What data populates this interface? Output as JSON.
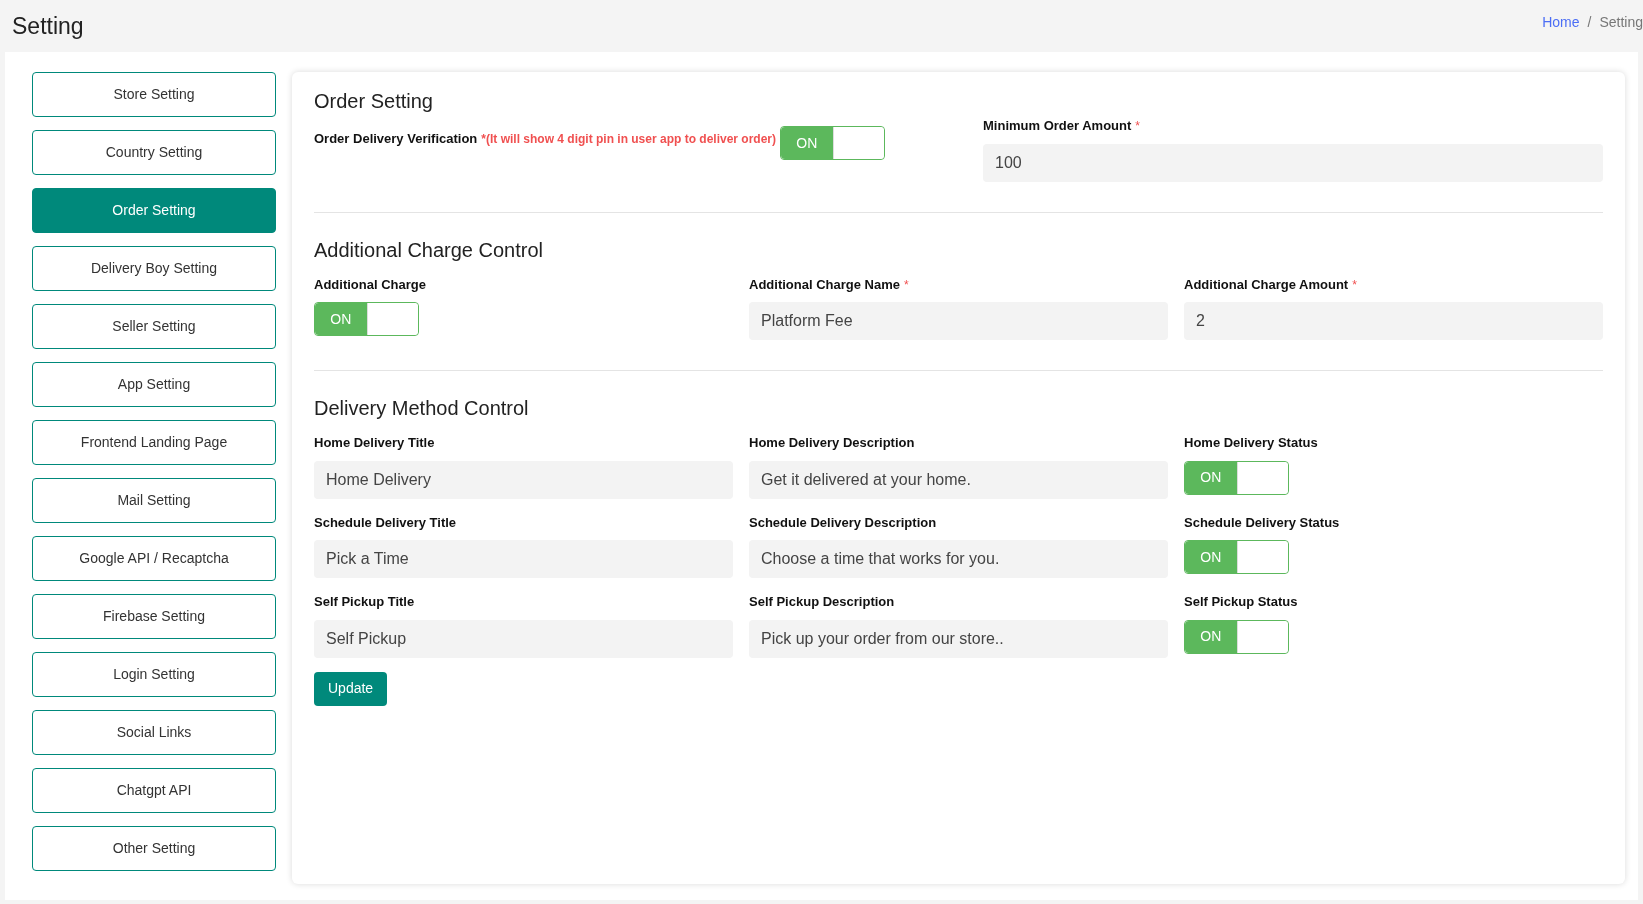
{
  "page": {
    "title": "Setting"
  },
  "breadcrumb": [
    {
      "label": "Home",
      "kind": "link"
    },
    {
      "label": "/",
      "kind": "separator"
    },
    {
      "label": "Setting",
      "kind": "current"
    }
  ],
  "sidebar": {
    "items": [
      {
        "label": "Store Setting",
        "selected": false
      },
      {
        "label": "Country Setting",
        "selected": false
      },
      {
        "label": "Order Setting",
        "selected": true
      },
      {
        "label": "Delivery Boy Setting",
        "selected": false
      },
      {
        "label": "Seller Setting",
        "selected": false
      },
      {
        "label": "App Setting",
        "selected": false
      },
      {
        "label": "Frontend Landing Page",
        "selected": false
      },
      {
        "label": "Mail Setting",
        "selected": false
      },
      {
        "label": "Google API / Recaptcha",
        "selected": false
      },
      {
        "label": "Firebase Setting",
        "selected": false
      },
      {
        "label": "Login Setting",
        "selected": false
      },
      {
        "label": "Social Links",
        "selected": false
      },
      {
        "label": "Chatgpt API",
        "selected": false
      },
      {
        "label": "Other Setting",
        "selected": false
      }
    ]
  },
  "sections": [
    {
      "title": "Order Setting",
      "kind": "split",
      "rows": [
        [
          {
            "kind": "toggle",
            "label": "Order Delivery Verification",
            "note": "*(It will show 4 digit pin in user app to deliver order)",
            "on": true,
            "on_text": "ON"
          },
          {
            "kind": "field",
            "label": "Minimum Order Amount",
            "mark": "*",
            "value": "100"
          }
        ]
      ]
    },
    {
      "title": "Additional Charge Control",
      "kind": "thirds",
      "rows": [
        [
          {
            "kind": "toggle",
            "label": "Additional Charge",
            "on": true,
            "on_text": "ON"
          },
          {
            "kind": "field",
            "label": "Additional Charge Name",
            "mark": "*",
            "value": "Platform Fee"
          },
          {
            "kind": "field",
            "label": "Additional Charge Amount",
            "mark": "*",
            "value": "2"
          }
        ]
      ]
    },
    {
      "title": "Delivery Method Control",
      "kind": "thirds",
      "rows": [
        [
          {
            "kind": "field",
            "label": "Home Delivery Title",
            "value": "Home Delivery"
          },
          {
            "kind": "field",
            "label": "Home Delivery Description",
            "value": "Get it delivered at your home."
          },
          {
            "kind": "toggle",
            "label": "Home Delivery Status",
            "on": true,
            "on_text": "ON"
          }
        ],
        [
          {
            "kind": "field",
            "label": "Schedule Delivery Title",
            "value": "Pick a Time"
          },
          {
            "kind": "field",
            "label": "Schedule Delivery Description",
            "value": "Choose a time that works for you."
          },
          {
            "kind": "toggle",
            "label": "Schedule Delivery Status",
            "on": true,
            "on_text": "ON"
          }
        ],
        [
          {
            "kind": "field",
            "label": "Self Pickup Title",
            "value": "Self Pickup"
          },
          {
            "kind": "field",
            "label": "Self Pickup Description",
            "value": "Pick up your order from our store.."
          },
          {
            "kind": "toggle",
            "label": "Self Pickup Status",
            "on": true,
            "on_text": "ON"
          }
        ]
      ]
    }
  ],
  "submit": {
    "label": "Update"
  }
}
